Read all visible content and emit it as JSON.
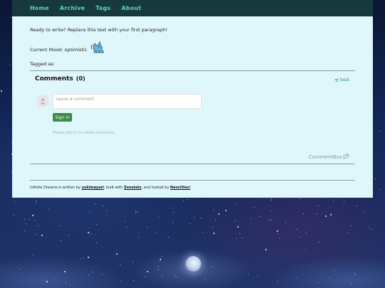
{
  "nav": {
    "items": [
      {
        "label": "Home"
      },
      {
        "label": "Archive"
      },
      {
        "label": "Tags"
      },
      {
        "label": "About"
      }
    ]
  },
  "post": {
    "intro": "Ready to write? Replace this text with your first paragraph!",
    "mood_label": "Current Mood: optimistic",
    "mood_icon": "pixel-cat-icon",
    "tagged_label": "Tagged as:"
  },
  "comments": {
    "title": "Comments",
    "count": "(0)",
    "sort_label": "best",
    "input_placeholder": "Leave a comment",
    "signin_button": "Sign In",
    "signin_note": "Please sign in to create comments.",
    "brand": "CommentBox"
  },
  "footer": {
    "prefix": "Infinite Dreams is written by",
    "author": "yukimayari",
    "built_with_text": ", built with",
    "builder": "Zonelets",
    "hosted_text": ", and hosted by",
    "host": "Neocities!"
  },
  "colors": {
    "nav_bg": "#17393e",
    "nav_link": "#55d7c9",
    "page_bg": "#dff6fb",
    "accent_green": "#3b8a45"
  }
}
